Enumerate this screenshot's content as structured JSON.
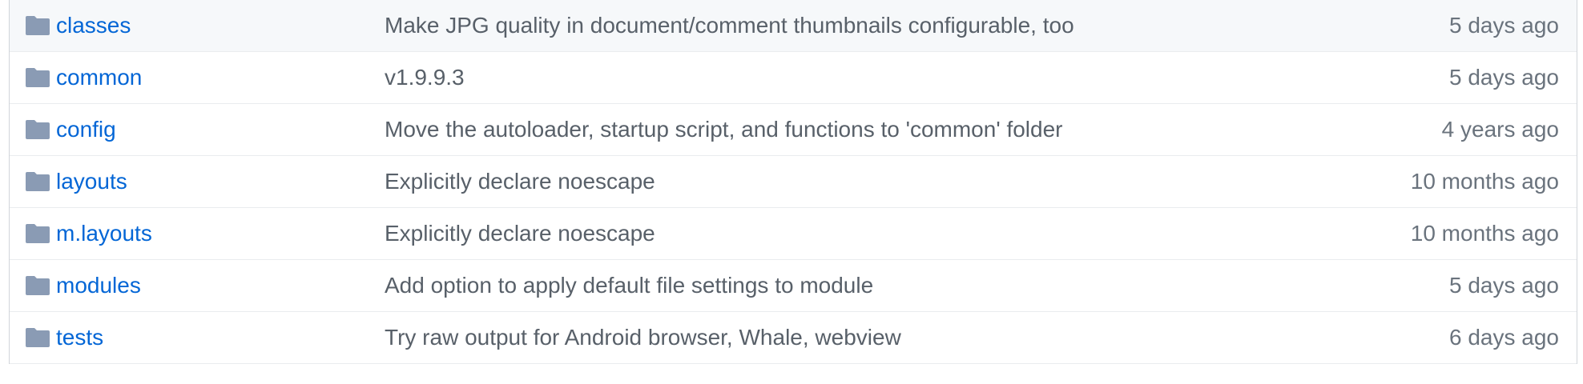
{
  "colors": {
    "folder_icon": "#79b8ff",
    "link": "#0366d6",
    "text": "#586069",
    "row_highlight": "#f6f8fa"
  },
  "rows": [
    {
      "icon": "folder-icon",
      "name": "classes",
      "message": "Make JPG quality in document/comment thumbnails configurable, too",
      "age": "5 days ago"
    },
    {
      "icon": "folder-icon",
      "name": "common",
      "message": "v1.9.9.3",
      "age": "5 days ago"
    },
    {
      "icon": "folder-icon",
      "name": "config",
      "message": "Move the autoloader, startup script, and functions to 'common' folder",
      "age": "4 years ago"
    },
    {
      "icon": "folder-icon",
      "name": "layouts",
      "message": "Explicitly declare noescape",
      "age": "10 months ago"
    },
    {
      "icon": "folder-icon",
      "name": "m.layouts",
      "message": "Explicitly declare noescape",
      "age": "10 months ago"
    },
    {
      "icon": "folder-icon",
      "name": "modules",
      "message": "Add option to apply default file settings to module",
      "age": "5 days ago"
    },
    {
      "icon": "folder-icon",
      "name": "tests",
      "message": "Try raw output for Android browser, Whale, webview",
      "age": "6 days ago"
    }
  ]
}
